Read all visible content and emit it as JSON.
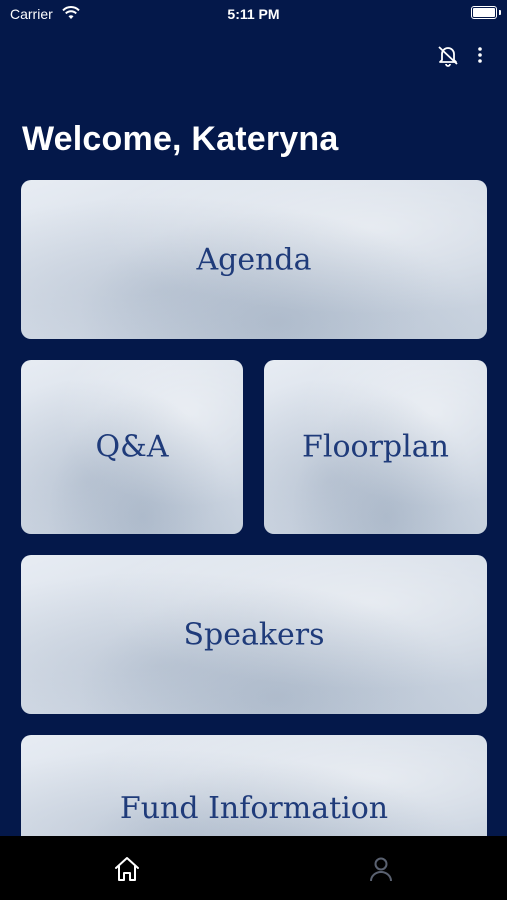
{
  "status_bar": {
    "carrier": "Carrier",
    "time": "5:11 PM"
  },
  "header": {
    "notification_icon": "notification-off-icon",
    "more_icon": "more-vertical-icon"
  },
  "welcome": "Welcome, Kateryna",
  "tiles": [
    {
      "label": "Agenda"
    },
    {
      "label": "Q&A"
    },
    {
      "label": "Floorplan"
    },
    {
      "label": "Speakers"
    },
    {
      "label": "Fund Information"
    }
  ],
  "tabbar": {
    "active": "home",
    "icons": [
      "home-icon",
      "profile-icon"
    ]
  },
  "colors": {
    "background": "#04184a",
    "tile_text": "#1f3b7a",
    "tabbar": "#000000"
  }
}
